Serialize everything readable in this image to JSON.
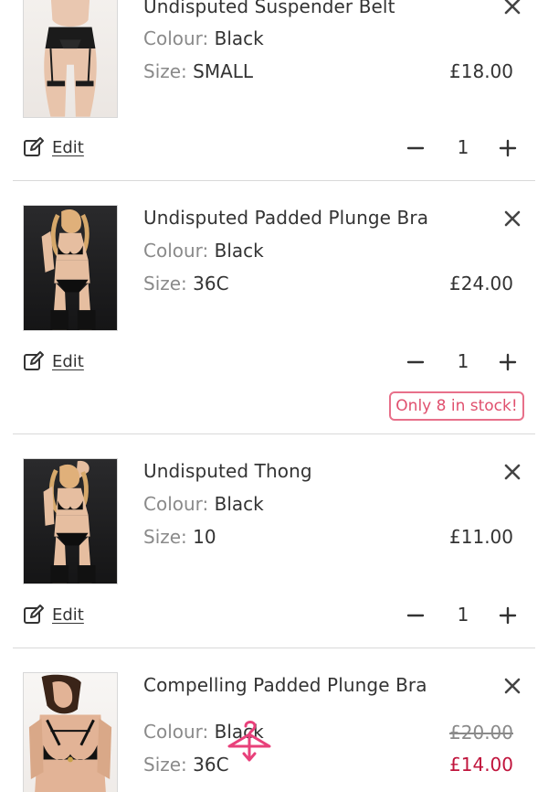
{
  "items": [
    {
      "title": "Undisputed Suspender Belt",
      "colour_label": "Colour:",
      "colour": "Black",
      "size_label": "Size:",
      "size": "SMALL",
      "price": "£18.00",
      "edit_label": "Edit",
      "quantity": "1"
    },
    {
      "title": "Undisputed Padded Plunge Bra",
      "colour_label": "Colour:",
      "colour": "Black",
      "size_label": "Size:",
      "size": "36C",
      "price": "£24.00",
      "edit_label": "Edit",
      "quantity": "1",
      "stock_badge": "Only 8 in stock!"
    },
    {
      "title": "Undisputed Thong",
      "colour_label": "Colour:",
      "colour": "Black",
      "size_label": "Size:",
      "size": "10",
      "price": "£11.00",
      "edit_label": "Edit",
      "quantity": "1"
    },
    {
      "title": "Compelling Padded Plunge Bra",
      "colour_label": "Colour:",
      "colour": "Black",
      "size_label": "Size:",
      "size": "36C",
      "original_price": "£20.00",
      "sale_price": "£14.00"
    }
  ],
  "icons": {
    "remove": "close-icon",
    "edit": "edit-icon",
    "minus": "minus-icon",
    "plus": "plus-icon",
    "loading": "hanger-icon"
  },
  "colors": {
    "text": "#333333",
    "muted": "#8a8a8a",
    "sale": "#c0143c",
    "badge": "#e0506e",
    "divider": "#d9d9d9",
    "hanger": "#e8407a"
  }
}
